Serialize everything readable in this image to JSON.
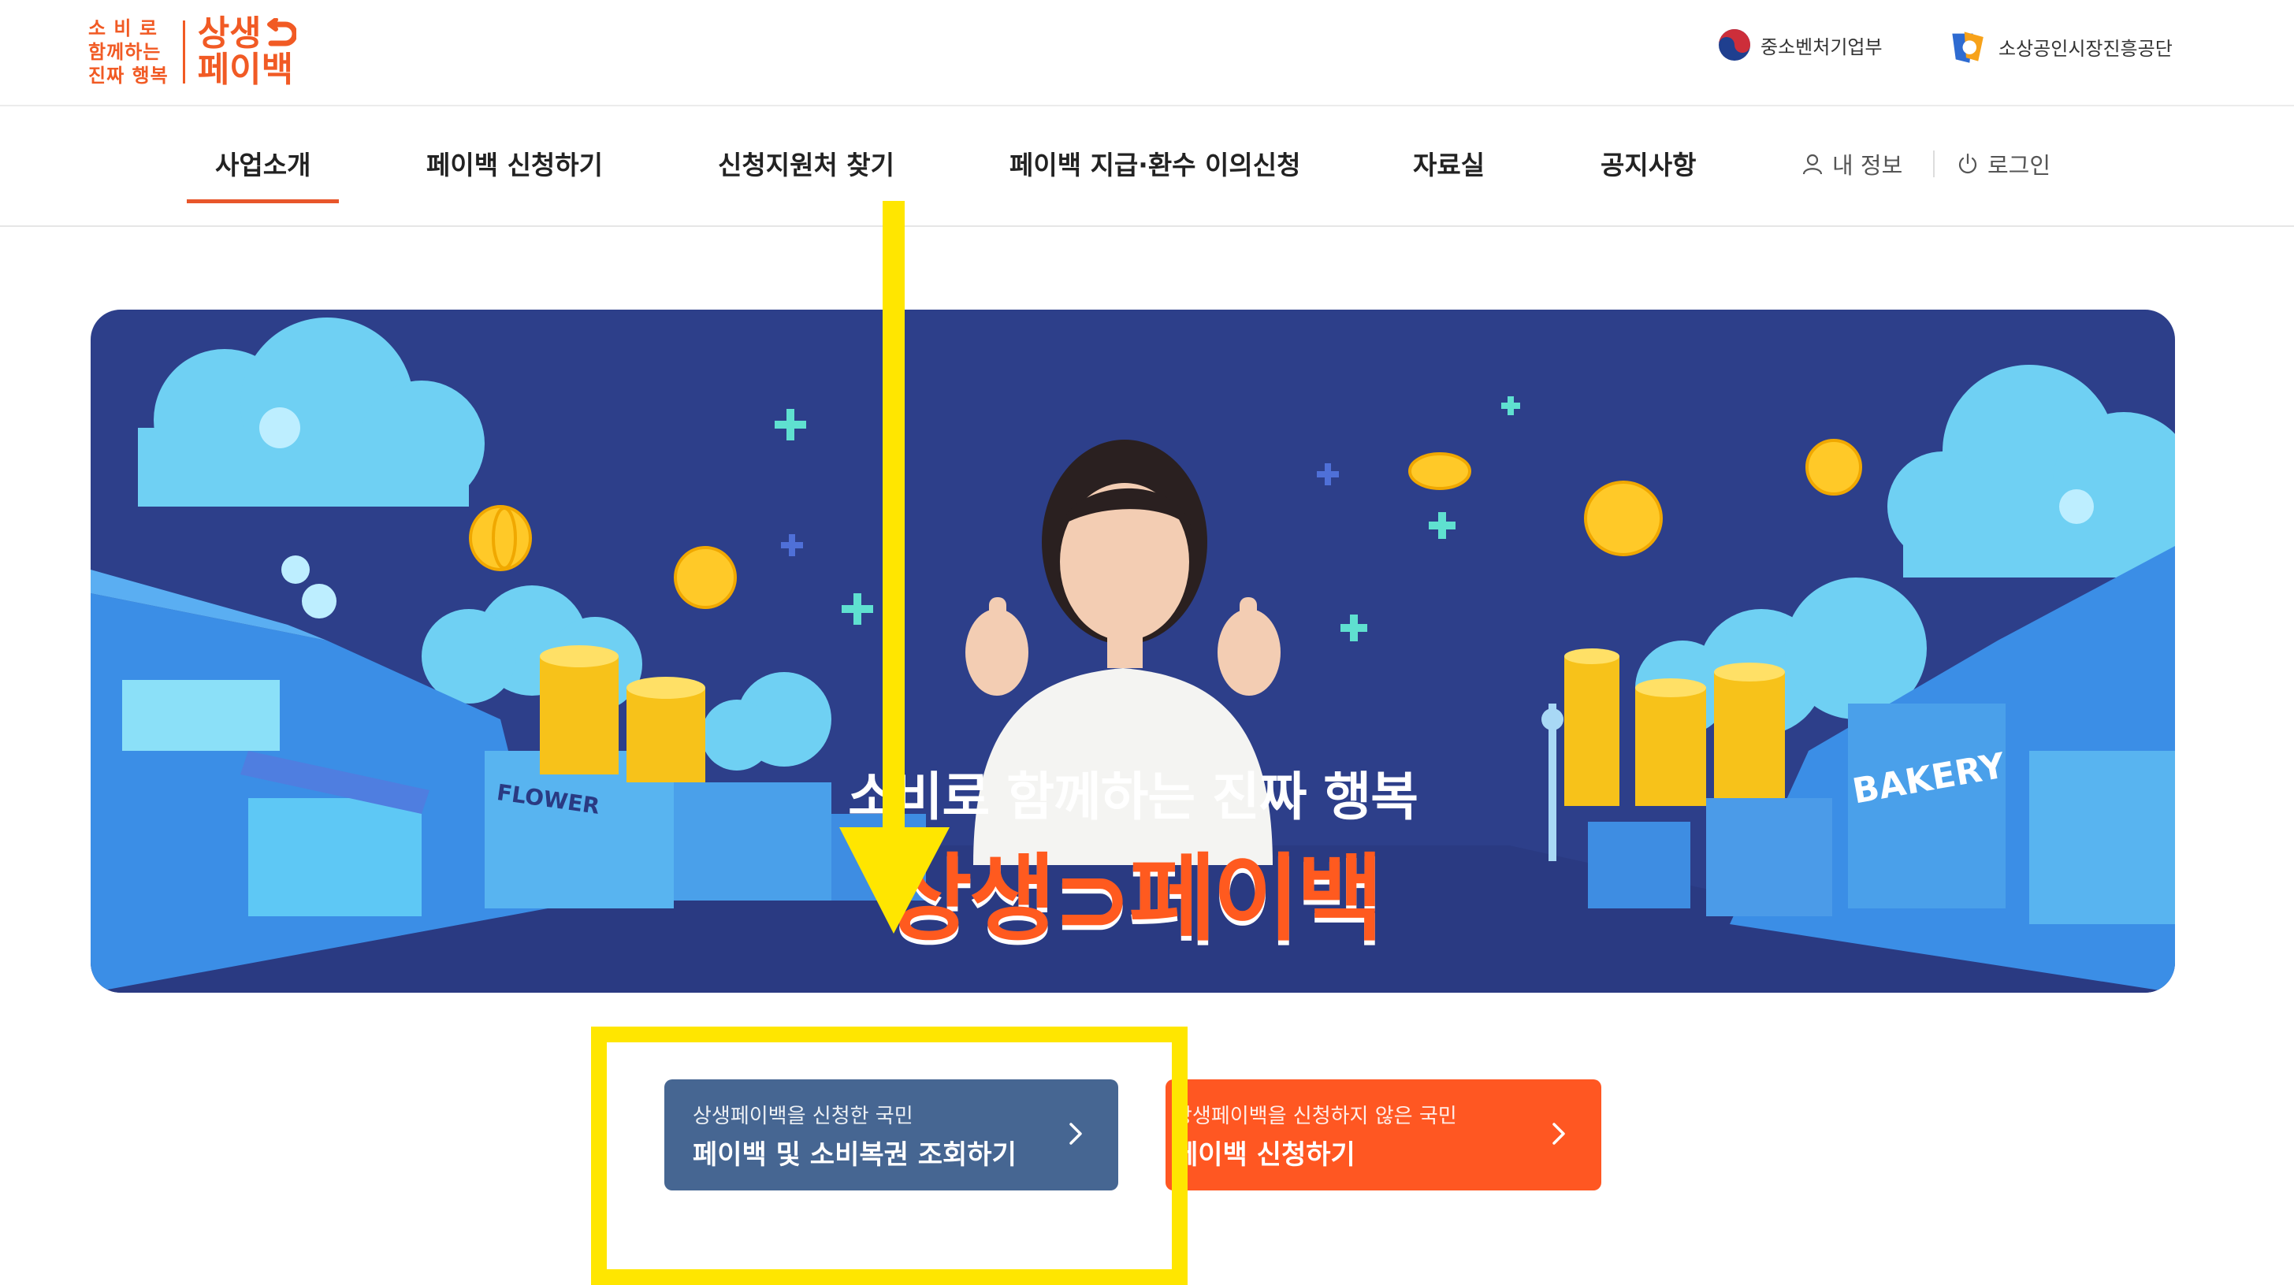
{
  "header": {
    "logo": {
      "slogan_lines": [
        "소 비 로",
        "함께하는",
        "진짜 행복"
      ],
      "brand_lines": [
        "상생",
        "페이백"
      ]
    },
    "orgs": [
      {
        "name": "중소벤처기업부",
        "icon": "korea-taegeuk-emblem-icon"
      },
      {
        "name": "소상공인시장진흥공단",
        "icon": "semas-logo-icon"
      }
    ]
  },
  "nav": {
    "items": [
      {
        "label": "사업소개",
        "active": true
      },
      {
        "label": "페이백 신청하기",
        "active": false
      },
      {
        "label": "신청지원처 찾기",
        "active": false
      },
      {
        "label": "페이백 지급·환수 이의신청",
        "active": false
      },
      {
        "label": "자료실",
        "active": false
      },
      {
        "label": "공지사항",
        "active": false
      }
    ],
    "my_info": {
      "label": "내 정보",
      "icon": "user-icon"
    },
    "login": {
      "label": "로그인",
      "icon": "power-icon"
    }
  },
  "banner": {
    "slogan": "소비로 함께하는 진짜 행복",
    "brand": "상생⊃페이백",
    "signs": {
      "flower": "FLOWER",
      "bakery": "BAKERY"
    }
  },
  "cta": {
    "applied": {
      "sub": "상생페이백을 신청한 국민",
      "main": "페이백 및 소비복권 조회하기",
      "icon": "chevron-right-icon"
    },
    "not_applied": {
      "sub": "상생페이백을 신청하지 않은 국민",
      "main": "페이백 신청하기",
      "icon": "chevron-right-icon"
    }
  },
  "colors": {
    "brand_orange": "#f15a24",
    "cta_blue": "#466692",
    "cta_orange": "#ff5722",
    "banner_navy": "#2d3f8a",
    "annotation_yellow": "#ffe600"
  }
}
